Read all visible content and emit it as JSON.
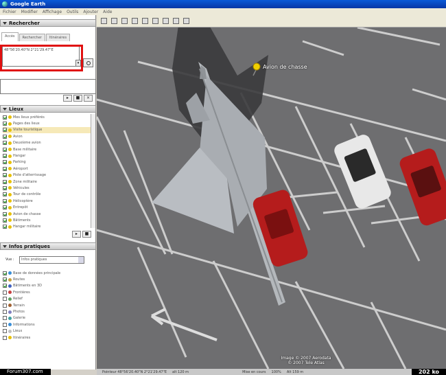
{
  "window": {
    "title": "Google Earth"
  },
  "menu": [
    "Fichier",
    "Modifier",
    "Affichage",
    "Outils",
    "Ajouter",
    "Aide"
  ],
  "search": {
    "header": "Rechercher",
    "tabs": [
      "Accès",
      "Rechercher",
      "Itinéraires"
    ],
    "query": "48°56'20.40\"N  2°21'29.47\"E"
  },
  "places": {
    "header": "Lieux",
    "items": [
      "Mes lieux préférés",
      "Pages des lieux",
      "Visite touristique",
      "Avion",
      "Deuxième avion",
      "Base militaire",
      "Hangar",
      "Parking",
      "Aéroport",
      "Piste d'atterrissage",
      "Zone militaire",
      "Véhicules",
      "Tour de contrôle",
      "Hélicoptère",
      "Entrepôt",
      "Avion de chasse",
      "Bâtiments",
      "Hangar militaire",
      "Autres lieux"
    ]
  },
  "layers": {
    "header": "Infos pratiques",
    "view_label": "Vue :",
    "view_value": "Infos pratiques",
    "items": [
      "Base de données principale",
      "Routes",
      "Bâtiments en 3D",
      "Frontières",
      "Relief",
      "Terrain",
      "Photos",
      "Galerie",
      "Informations",
      "Lieux",
      "Itinéraires"
    ]
  },
  "map": {
    "placemark": "Avion de chasse",
    "credit_line1": "Image © 2007 Aerodata",
    "credit_line2": "© 2007 Tele Atlas"
  },
  "status": {
    "pointer": "Pointeur 48°56'20.40\"N 2°21'29.47\"E",
    "elev": "alt 120 m",
    "streaming": "Mise en cours",
    "stream_pct": "100%",
    "eye_alt": "Alt 159 m"
  },
  "watermark": {
    "forum": "Forum307.com",
    "size": "202 ko"
  }
}
